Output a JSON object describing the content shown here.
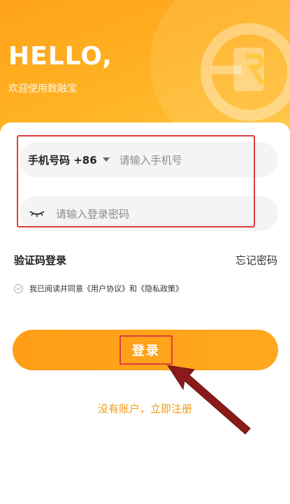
{
  "header": {
    "greeting": "HELLO,",
    "welcome": "欢迎使用数融宝"
  },
  "login_form": {
    "country_code": "手机号码 +86",
    "phone_placeholder": "请输入手机号",
    "password_placeholder": "请输入登录密码"
  },
  "links": {
    "sms_login": "验证码登录",
    "forgot_password": "忘记密码"
  },
  "agreement": {
    "text": "我已阅读并同意《用户协议》和《隐私政策》"
  },
  "buttons": {
    "login": "登录"
  },
  "register_link": "没有账户，立即注册",
  "colors": {
    "brand_orange": "#ffa21c",
    "annotation_red": "#e03c3c",
    "arrow_dark_red": "#8b1a1a"
  },
  "icons": {
    "logo": "brand-logo-icon",
    "eye": "eye-closed-icon",
    "caret": "caret-down-icon",
    "check": "check-circle-icon"
  }
}
